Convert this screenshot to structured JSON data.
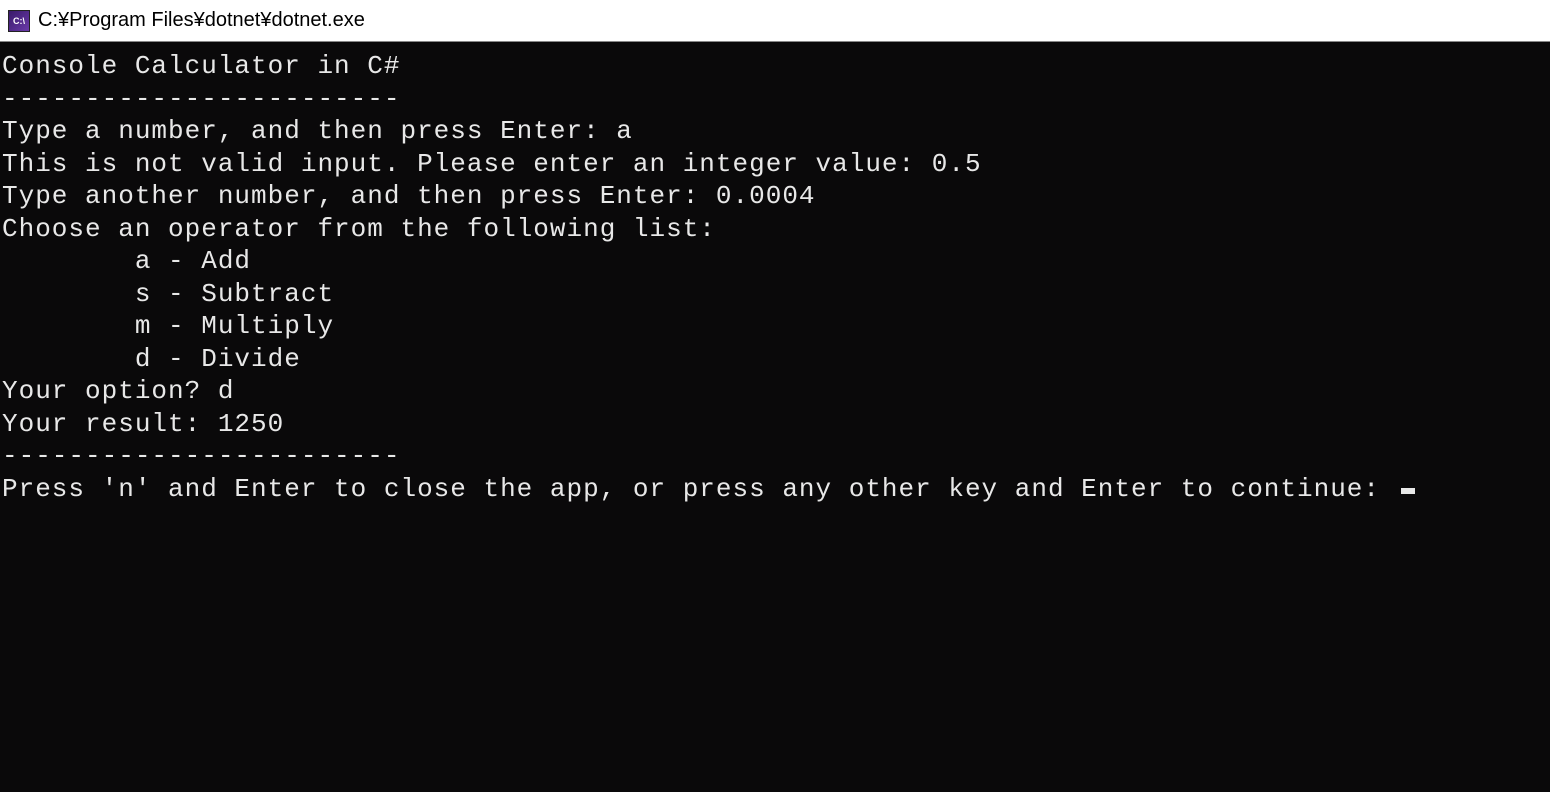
{
  "window": {
    "icon_label": "C:\\",
    "title": "C:¥Program Files¥dotnet¥dotnet.exe"
  },
  "terminal": {
    "header": "Console Calculator in C#",
    "hr1": "------------------------",
    "blank1": "",
    "prompt_first_number": "Type a number, and then press Enter: a",
    "invalid_input": "This is not valid input. Please enter an integer value: 0.5",
    "prompt_second_number": "Type another number, and then press Enter: 0.0004",
    "choose_operator": "Choose an operator from the following list:",
    "op_add": "        a - Add",
    "op_sub": "        s - Subtract",
    "op_mul": "        m - Multiply",
    "op_div": "        d - Divide",
    "your_option": "Your option? d",
    "your_result": "Your result: 1250",
    "blank2": "",
    "hr2": "------------------------",
    "blank3": "",
    "continue_prompt": "Press 'n' and Enter to close the app, or press any other key and Enter to continue: "
  }
}
